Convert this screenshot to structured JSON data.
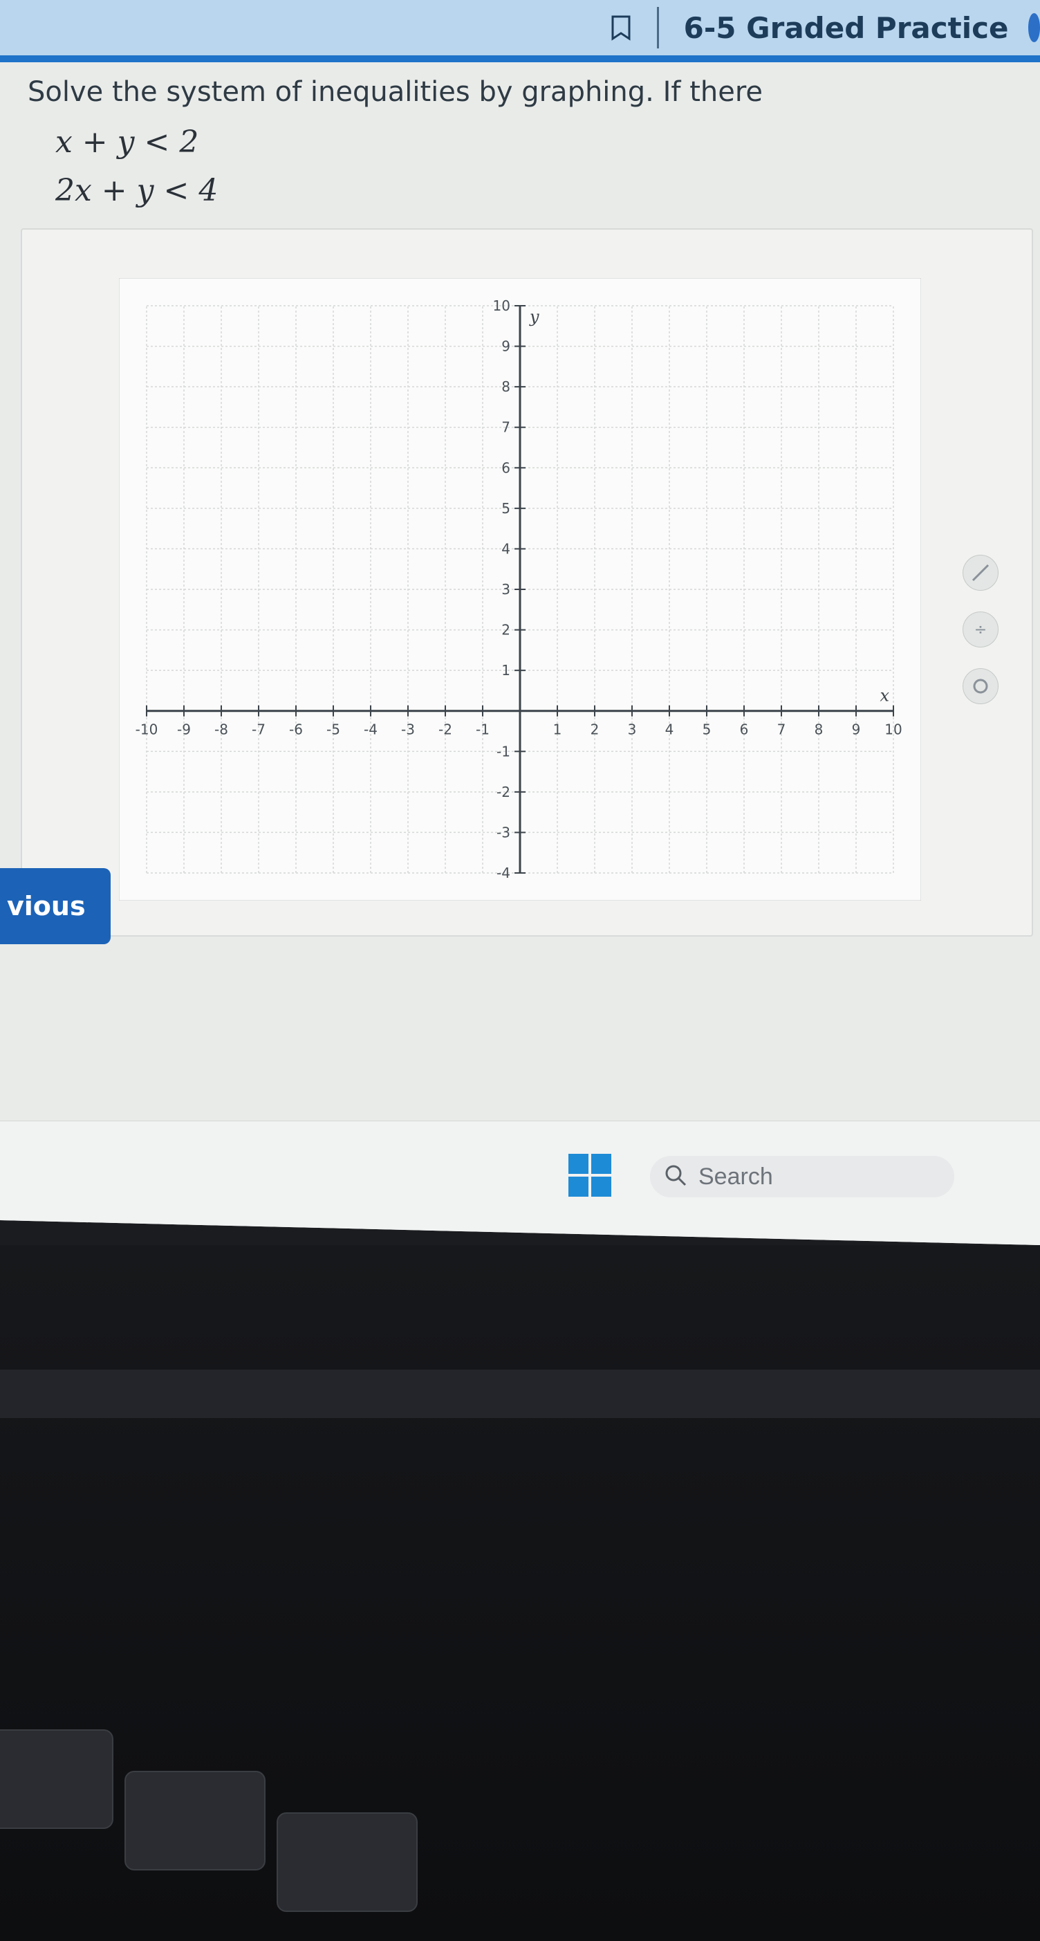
{
  "header": {
    "assignment_title": "6-5 Graded Practice"
  },
  "question": {
    "prompt": "Solve the system of inequalities by graphing. If there",
    "inequalities": [
      "x + y < 2",
      "2x + y < 4"
    ]
  },
  "graph": {
    "x_range": [
      -10,
      10
    ],
    "y_range": [
      -4,
      10
    ],
    "x_axis_label": "x",
    "y_axis_label": "y",
    "x_tick_labels": [
      "-10",
      "-9",
      "-8",
      "-7",
      "-6",
      "-5",
      "-4",
      "-3",
      "-2",
      "-1",
      "1",
      "2",
      "3",
      "4",
      "5",
      "6",
      "7",
      "8",
      "9",
      "10"
    ],
    "y_tick_labels": [
      "-4",
      "-3",
      "-2",
      "-1",
      "1",
      "2",
      "3",
      "4",
      "5",
      "6",
      "7",
      "8",
      "9",
      "10"
    ]
  },
  "navigation": {
    "previous_label": "vious"
  },
  "taskbar": {
    "search_placeholder": "Search"
  },
  "colors": {
    "header_blue": "#1f73c9",
    "button_blue": "#1c63b7"
  },
  "icons": [
    "bookmark-icon",
    "user-avatar-icon",
    "windows-start-icon",
    "search-icon",
    "graph-tool-icon"
  ]
}
